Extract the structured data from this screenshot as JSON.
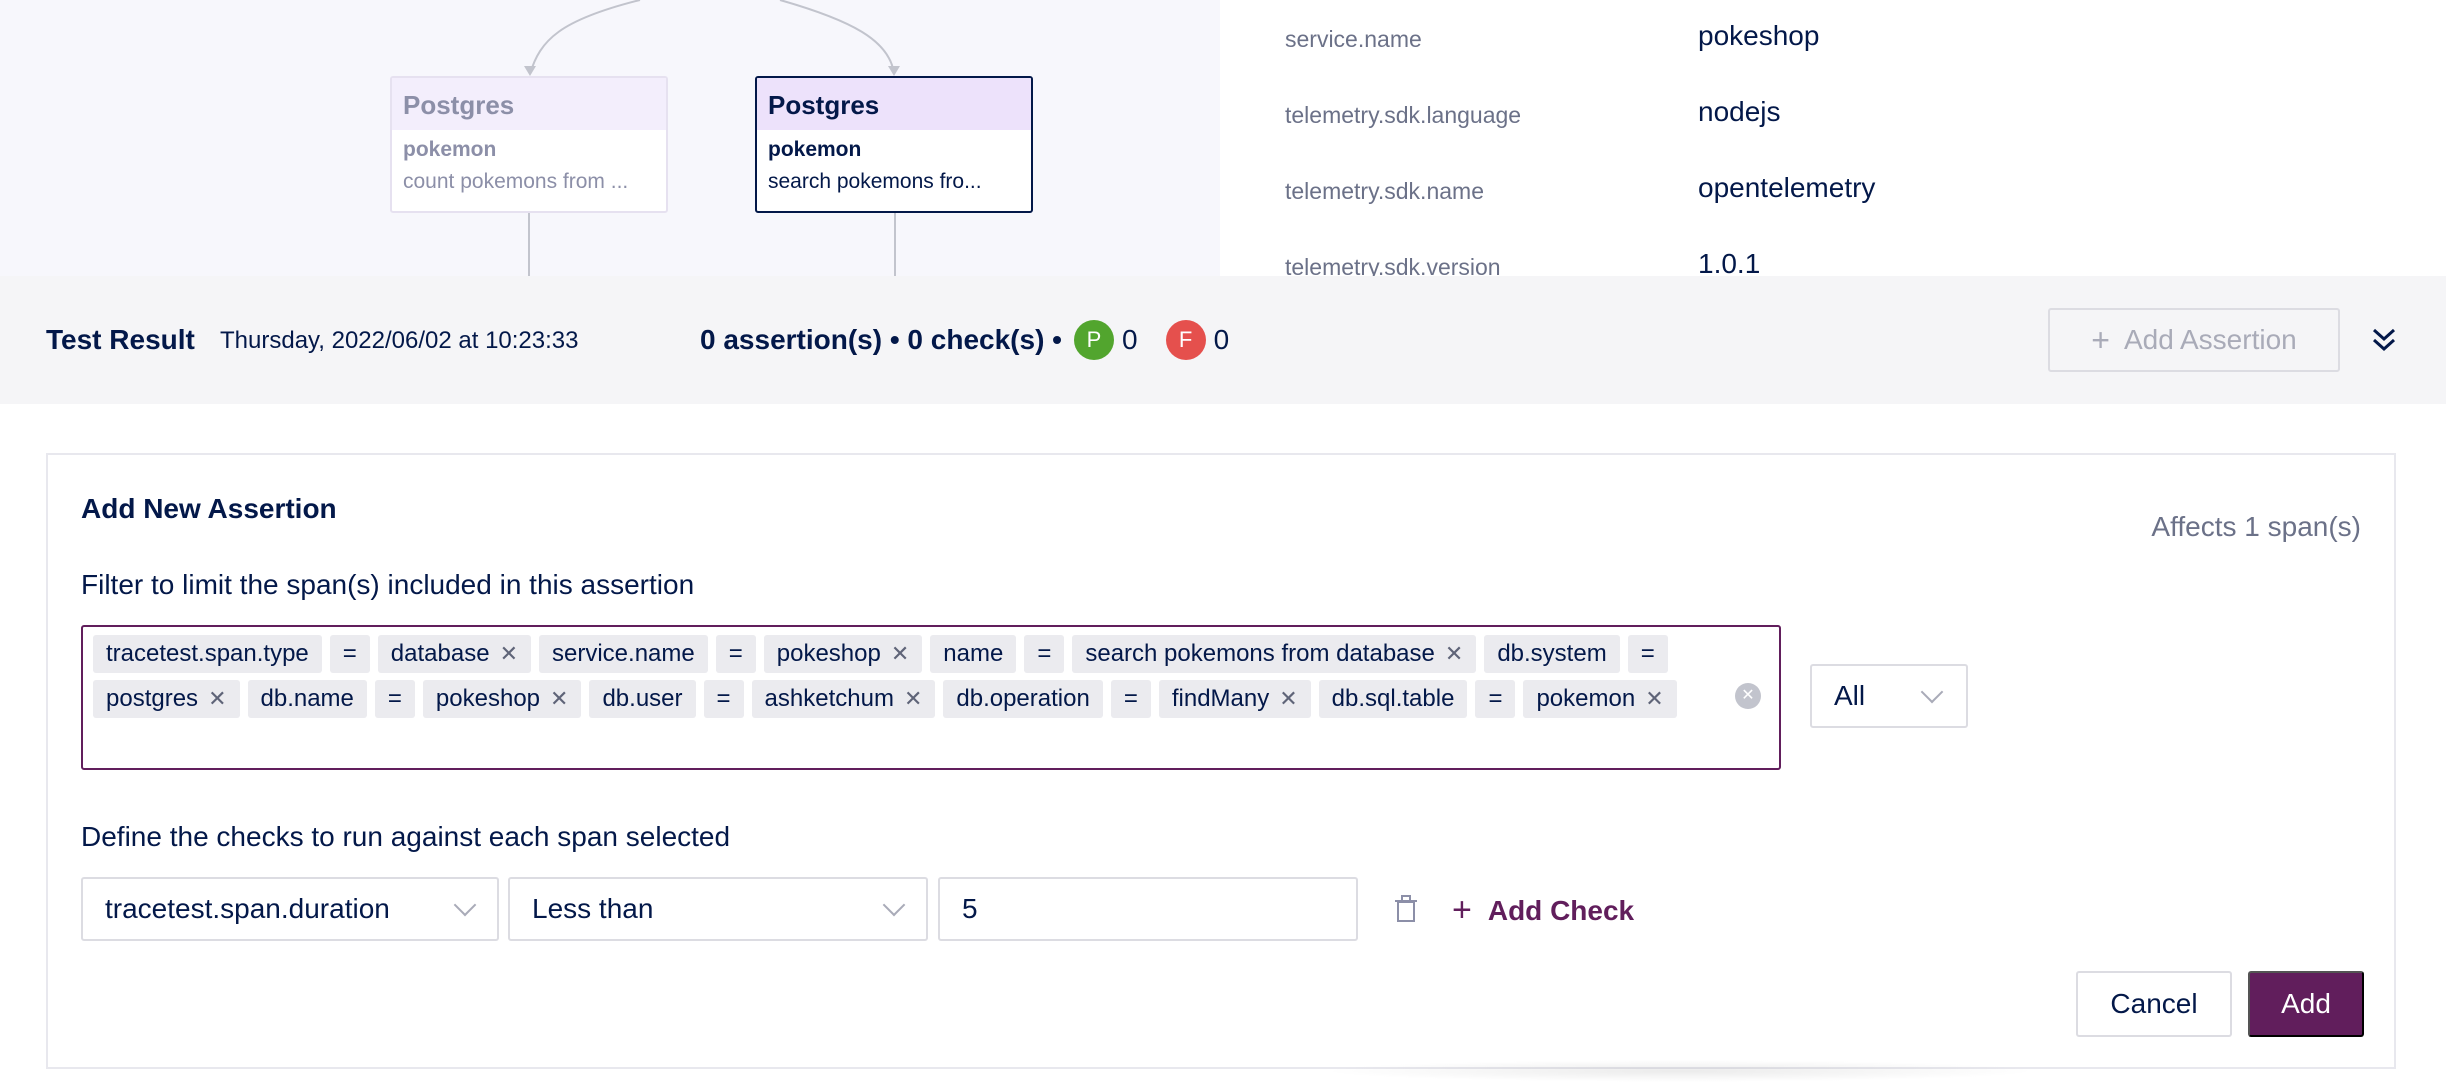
{
  "diagram": {
    "nodes": [
      {
        "kind": "Postgres",
        "service": "pokemon",
        "span": "count pokemons from ..."
      },
      {
        "kind": "Postgres",
        "service": "pokemon",
        "span": "search pokemons fro..."
      }
    ]
  },
  "attributes": [
    {
      "key": "service.name",
      "value": "pokeshop"
    },
    {
      "key": "telemetry.sdk.language",
      "value": "nodejs"
    },
    {
      "key": "telemetry.sdk.name",
      "value": "opentelemetry"
    },
    {
      "key": "telemetry.sdk.version",
      "value": "1.0.1"
    }
  ],
  "result_bar": {
    "title": "Test Result",
    "date": "Thursday, 2022/06/02 at 10:23:33",
    "summary": "0 assertion(s) • 0 check(s) •",
    "pass_badge": "P",
    "pass_count": "0",
    "fail_badge": "F",
    "fail_count": "0",
    "add_assertion_label": "Add Assertion"
  },
  "form": {
    "title": "Add New Assertion",
    "affects": "Affects 1 span(s)",
    "filter_label": "Filter to limit the span(s) included in this assertion",
    "filter_tags": [
      {
        "text": "tracetest.span.type",
        "removable": false
      },
      {
        "text": "=",
        "removable": false
      },
      {
        "text": "database",
        "removable": true
      },
      {
        "text": "service.name",
        "removable": false
      },
      {
        "text": "=",
        "removable": false
      },
      {
        "text": "pokeshop",
        "removable": true
      },
      {
        "text": "name",
        "removable": false
      },
      {
        "text": "=",
        "removable": false
      },
      {
        "text": "search pokemons from database",
        "removable": true
      },
      {
        "text": "db.system",
        "removable": false
      },
      {
        "text": "=",
        "removable": false
      },
      {
        "text": "postgres",
        "removable": true
      },
      {
        "text": "db.name",
        "removable": false
      },
      {
        "text": "=",
        "removable": false
      },
      {
        "text": "pokeshop",
        "removable": true
      },
      {
        "text": "db.user",
        "removable": false
      },
      {
        "text": "=",
        "removable": false
      },
      {
        "text": "ashketchum",
        "removable": true
      },
      {
        "text": "db.operation",
        "removable": false
      },
      {
        "text": "=",
        "removable": false
      },
      {
        "text": "findMany",
        "removable": true
      },
      {
        "text": "db.sql.table",
        "removable": false
      },
      {
        "text": "=",
        "removable": false
      },
      {
        "text": "pokemon",
        "removable": true
      }
    ],
    "selector": "All",
    "checks_label": "Define the checks to run against each span selected",
    "check": {
      "attribute": "tracetest.span.duration",
      "operator": "Less than",
      "value": "5"
    },
    "add_check_label": "Add Check",
    "cancel_label": "Cancel",
    "add_label": "Add"
  },
  "colors": {
    "brand": "#611e5c",
    "pass": "#52a52e",
    "fail": "#e5504d",
    "text": "#031849"
  }
}
